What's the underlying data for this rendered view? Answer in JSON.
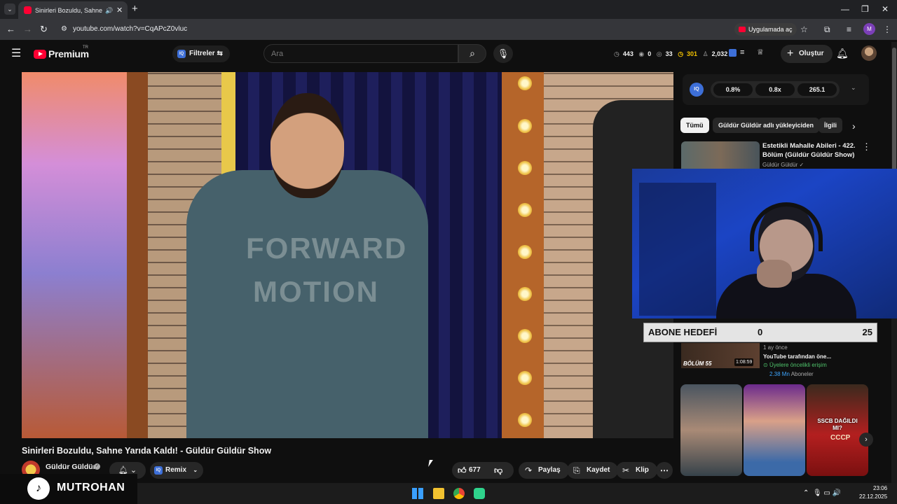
{
  "browser": {
    "tab_title": "Sinirleri Bozuldu, Sahne Yarıda Kaldı! - Güldür Güldür Show",
    "new_tab": "+",
    "url": "youtube.com/watch?v=CqAPcZ0vluc",
    "open_in_app": "Uygulamada aç",
    "profile_initial": "M",
    "window_controls": [
      "—",
      "❐",
      "✕"
    ]
  },
  "header": {
    "brand": "Premium",
    "country": "TR",
    "filters_label": "Filtreler",
    "search_placeholder": "Ara",
    "stats": {
      "watch": "443",
      "views": "0",
      "eye": "33",
      "coins": "301",
      "users": "2,032"
    },
    "create_label": "Oluştur"
  },
  "video": {
    "shirt_line1": "FORWARD",
    "shirt_line2": "MOTION",
    "title": "Sinirleri Bozuldu, Sahne Yarıda Kaldı! - Güldür Güldür Show",
    "channel": "Güldür Güldür",
    "remix_label": "Remix",
    "likes": "677",
    "share_label": "Paylaş",
    "save_label": "Kaydet",
    "clip_label": "Klip"
  },
  "extension": {
    "logo": "IQ",
    "values": [
      "0.8%",
      "0.8x",
      "265.1"
    ]
  },
  "chips": [
    "Tümü",
    "Güldür Güldür adlı yükleyiciden",
    "İlgili"
  ],
  "recommendations": [
    {
      "title": "Estetikli Mahalle Abileri - 422. Bölüm (Güldür Güldür Show)",
      "channel": "Güldür Güldür"
    },
    {
      "episode_label": "BÖLÜM 55",
      "duration": "1:08:59",
      "age": "1 ay önce",
      "from": "YouTube tarafından öne...",
      "members": "Üyelere öncelikli erişim",
      "subs_count": "2.38 Mn",
      "subs_label": "Aboneler"
    }
  ],
  "shorts": {
    "caption": "SSCB DAĞILDI MI?",
    "tag": "CCCP"
  },
  "sub_goal": {
    "label": "ABONE HEDEFİ",
    "current": "0",
    "target": "25"
  },
  "streamer": {
    "name": "MUTROHAN"
  },
  "taskbar": {
    "time": "23:06",
    "date": "22.12.2025"
  }
}
